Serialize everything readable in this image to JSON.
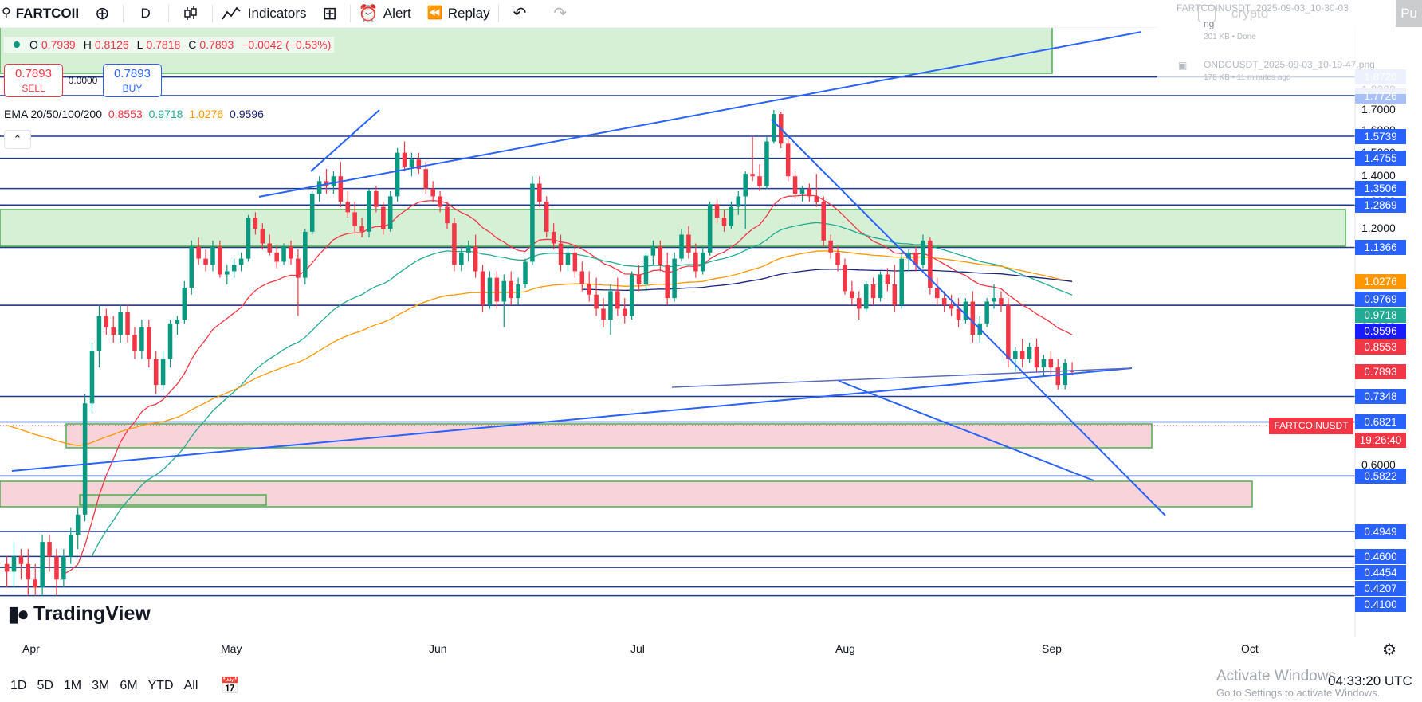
{
  "toolbar": {
    "symbol": "FARTCOII",
    "interval": "D",
    "indicators": "Indicators",
    "alert": "Alert",
    "replay": "Replay",
    "search_text": "crypto",
    "publish_partial": "Pu"
  },
  "downloads": {
    "item1_name": "FARTCOINUSDT_2025-09-03_10-30-03",
    "item1_partial": "ng",
    "item1_meta": "201 KB • Done",
    "item2_name": "ONDOUSDT_2025-09-03_10-19-47.png",
    "item2_meta": "178 KB • 11 minutes ago"
  },
  "legend": {
    "open_label": "O",
    "open": "0.7939",
    "high_label": "H",
    "high": "0.8126",
    "low_label": "L",
    "low": "0.7818",
    "close_label": "C",
    "close": "0.7893",
    "change": "−0.0042 (−0.53%)"
  },
  "trade": {
    "sell_price": "0.7893",
    "sell_label": "SELL",
    "spread": "0.0000",
    "buy_price": "0.7893",
    "buy_label": "BUY"
  },
  "ema": {
    "label": "EMA 20/50/100/200",
    "v20": "0.8553",
    "v50": "0.9718",
    "v100": "1.0276",
    "v200": "0.9596",
    "c20": "#f23645",
    "c50": "#22ab94",
    "c100": "#ff9800",
    "c200": "#1a237e"
  },
  "price_scale": {
    "plain": [
      "1.8000",
      "1.7000",
      "1.6000",
      "1.5000",
      "1.4000",
      "1.3000",
      "1.2000",
      "0.9000",
      "0.6000"
    ],
    "levels": [
      {
        "text": "1.8720",
        "bg": "#a9bff7"
      },
      {
        "text": "1.7726",
        "bg": "#a9bff7"
      },
      {
        "text": "1.5739",
        "bg": "#2962ff"
      },
      {
        "text": "1.4755",
        "bg": "#2962ff"
      },
      {
        "text": "1.3506",
        "bg": "#2962ff"
      },
      {
        "text": "1.2869",
        "bg": "#2962ff"
      },
      {
        "text": "1.1366",
        "bg": "#2962ff"
      },
      {
        "text": "1.0276",
        "bg": "#ff9800"
      },
      {
        "text": "0.9769",
        "bg": "#2962ff"
      },
      {
        "text": "0.9718",
        "bg": "#22ab94"
      },
      {
        "text": "0.9596",
        "bg": "#1a1aff"
      },
      {
        "text": "0.8553",
        "bg": "#f23645"
      },
      {
        "text": "0.7893",
        "bg": "#f23645"
      },
      {
        "text": "0.7348",
        "bg": "#2962ff"
      },
      {
        "text": "0.6821",
        "bg": "#2962ff"
      },
      {
        "text": "0.5822",
        "bg": "#2962ff"
      },
      {
        "text": "0.4949",
        "bg": "#2962ff"
      },
      {
        "text": "0.4600",
        "bg": "#2962ff"
      },
      {
        "text": "0.4454",
        "bg": "#2962ff"
      },
      {
        "text": "0.4207",
        "bg": "#2962ff"
      },
      {
        "text": "0.4100",
        "bg": "#2962ff"
      }
    ],
    "symbol_tag": "FARTCOINUSDT",
    "countdown": "19:26:40"
  },
  "time_axis": [
    "Apr",
    "May",
    "Jun",
    "Jul",
    "Aug",
    "Sep",
    "Oct"
  ],
  "branding": "TradingView",
  "bottom": {
    "ranges": [
      "1D",
      "5D",
      "1M",
      "3M",
      "6M",
      "YTD",
      "All"
    ],
    "clock": "04:33:20 UTC"
  },
  "watermark": {
    "title": "Activate Windows",
    "subtitle": "Go to Settings to activate Windows."
  },
  "chart_data": {
    "type": "candlestick",
    "symbol": "FARTCOINUSDT",
    "interval": "1D",
    "x_range": [
      "2025-03-30",
      "2025-10-15"
    ],
    "y_range": [
      0.39,
      1.93
    ],
    "candles": [
      [
        0.45,
        0.46,
        0.42,
        0.44
      ],
      [
        0.44,
        0.48,
        0.42,
        0.46
      ],
      [
        0.46,
        0.47,
        0.43,
        0.45
      ],
      [
        0.45,
        0.47,
        0.41,
        0.43
      ],
      [
        0.43,
        0.45,
        0.41,
        0.42
      ],
      [
        0.42,
        0.49,
        0.41,
        0.48
      ],
      [
        0.48,
        0.49,
        0.44,
        0.46
      ],
      [
        0.46,
        0.47,
        0.41,
        0.43
      ],
      [
        0.43,
        0.47,
        0.42,
        0.46
      ],
      [
        0.46,
        0.5,
        0.45,
        0.49
      ],
      [
        0.49,
        0.53,
        0.47,
        0.52
      ],
      [
        0.52,
        0.74,
        0.51,
        0.72
      ],
      [
        0.72,
        0.86,
        0.7,
        0.84
      ],
      [
        0.84,
        0.96,
        0.8,
        0.93
      ],
      [
        0.93,
        0.95,
        0.88,
        0.9
      ],
      [
        0.9,
        0.93,
        0.86,
        0.88
      ],
      [
        0.88,
        0.96,
        0.86,
        0.94
      ],
      [
        0.94,
        0.96,
        0.86,
        0.88
      ],
      [
        0.88,
        0.9,
        0.82,
        0.84
      ],
      [
        0.84,
        0.92,
        0.82,
        0.9
      ],
      [
        0.9,
        0.92,
        0.8,
        0.82
      ],
      [
        0.82,
        0.84,
        0.74,
        0.76
      ],
      [
        0.76,
        0.84,
        0.75,
        0.82
      ],
      [
        0.82,
        0.92,
        0.8,
        0.91
      ],
      [
        0.91,
        0.93,
        0.88,
        0.92
      ],
      [
        0.92,
        1.03,
        0.91,
        1.01
      ],
      [
        1.01,
        1.16,
        0.99,
        1.14
      ],
      [
        1.14,
        1.17,
        1.08,
        1.1
      ],
      [
        1.1,
        1.13,
        1.06,
        1.08
      ],
      [
        1.08,
        1.16,
        1.06,
        1.14
      ],
      [
        1.14,
        1.16,
        1.04,
        1.05
      ],
      [
        1.05,
        1.08,
        1.02,
        1.06
      ],
      [
        1.06,
        1.1,
        1.04,
        1.08
      ],
      [
        1.08,
        1.12,
        1.06,
        1.1
      ],
      [
        1.1,
        1.25,
        1.09,
        1.24
      ],
      [
        1.24,
        1.26,
        1.18,
        1.2
      ],
      [
        1.2,
        1.22,
        1.13,
        1.15
      ],
      [
        1.15,
        1.18,
        1.11,
        1.12
      ],
      [
        1.12,
        1.14,
        1.07,
        1.09
      ],
      [
        1.09,
        1.15,
        1.08,
        1.14
      ],
      [
        1.14,
        1.16,
        1.08,
        1.1
      ],
      [
        1.1,
        1.13,
        0.93,
        1.04
      ],
      [
        1.04,
        1.2,
        1.02,
        1.19
      ],
      [
        1.19,
        1.34,
        1.18,
        1.33
      ],
      [
        1.33,
        1.4,
        1.3,
        1.38
      ],
      [
        1.38,
        1.43,
        1.33,
        1.36
      ],
      [
        1.36,
        1.42,
        1.33,
        1.4
      ],
      [
        1.4,
        1.46,
        1.28,
        1.3
      ],
      [
        1.3,
        1.34,
        1.24,
        1.26
      ],
      [
        1.26,
        1.3,
        1.19,
        1.21
      ],
      [
        1.21,
        1.24,
        1.17,
        1.19
      ],
      [
        1.19,
        1.35,
        1.17,
        1.34
      ],
      [
        1.34,
        1.36,
        1.26,
        1.28
      ],
      [
        1.28,
        1.3,
        1.18,
        1.2
      ],
      [
        1.2,
        1.34,
        1.19,
        1.32
      ],
      [
        1.32,
        1.52,
        1.3,
        1.5
      ],
      [
        1.5,
        1.55,
        1.42,
        1.44
      ],
      [
        1.44,
        1.5,
        1.4,
        1.47
      ],
      [
        1.47,
        1.5,
        1.41,
        1.43
      ],
      [
        1.43,
        1.46,
        1.33,
        1.35
      ],
      [
        1.35,
        1.38,
        1.3,
        1.32
      ],
      [
        1.32,
        1.34,
        1.26,
        1.28
      ],
      [
        1.28,
        1.3,
        1.2,
        1.22
      ],
      [
        1.22,
        1.24,
        1.06,
        1.08
      ],
      [
        1.08,
        1.14,
        1.06,
        1.12
      ],
      [
        1.12,
        1.16,
        1.09,
        1.14
      ],
      [
        1.14,
        1.18,
        1.04,
        1.06
      ],
      [
        1.06,
        1.08,
        0.94,
        0.96
      ],
      [
        0.96,
        1.06,
        0.95,
        1.04
      ],
      [
        1.04,
        1.06,
        0.95,
        0.97
      ],
      [
        0.97,
        1.05,
        0.9,
        1.03
      ],
      [
        1.03,
        1.06,
        0.96,
        0.98
      ],
      [
        0.98,
        1.04,
        0.96,
        1.02
      ],
      [
        1.02,
        1.1,
        1.01,
        1.09
      ],
      [
        1.09,
        1.4,
        1.08,
        1.37
      ],
      [
        1.37,
        1.4,
        1.28,
        1.3
      ],
      [
        1.3,
        1.32,
        1.17,
        1.19
      ],
      [
        1.19,
        1.22,
        1.13,
        1.15
      ],
      [
        1.15,
        1.18,
        1.06,
        1.08
      ],
      [
        1.08,
        1.14,
        1.06,
        1.12
      ],
      [
        1.12,
        1.14,
        1.04,
        1.06
      ],
      [
        1.06,
        1.09,
        1.0,
        1.02
      ],
      [
        1.02,
        1.06,
        0.97,
        0.99
      ],
      [
        0.99,
        1.04,
        0.93,
        0.95
      ],
      [
        0.95,
        0.98,
        0.9,
        0.92
      ],
      [
        0.92,
        1.02,
        0.88,
        1.0
      ],
      [
        1.0,
        1.04,
        0.93,
        0.95
      ],
      [
        0.95,
        0.98,
        0.91,
        0.93
      ],
      [
        0.93,
        1.06,
        0.92,
        1.05
      ],
      [
        1.05,
        1.08,
        1.0,
        1.02
      ],
      [
        1.02,
        1.12,
        1.0,
        1.11
      ],
      [
        1.11,
        1.16,
        1.08,
        1.14
      ],
      [
        1.14,
        1.16,
        1.06,
        1.08
      ],
      [
        1.08,
        1.12,
        0.96,
        0.98
      ],
      [
        0.98,
        1.12,
        0.97,
        1.1
      ],
      [
        1.1,
        1.2,
        1.09,
        1.18
      ],
      [
        1.18,
        1.21,
        1.1,
        1.12
      ],
      [
        1.12,
        1.15,
        1.04,
        1.06
      ],
      [
        1.06,
        1.14,
        1.05,
        1.12
      ],
      [
        1.12,
        1.3,
        1.11,
        1.29
      ],
      [
        1.29,
        1.31,
        1.22,
        1.24
      ],
      [
        1.24,
        1.27,
        1.19,
        1.21
      ],
      [
        1.21,
        1.3,
        1.2,
        1.28
      ],
      [
        1.28,
        1.34,
        1.25,
        1.32
      ],
      [
        1.32,
        1.42,
        1.2,
        1.41
      ],
      [
        1.41,
        1.57,
        1.38,
        1.4
      ],
      [
        1.4,
        1.45,
        1.34,
        1.36
      ],
      [
        1.36,
        1.57,
        1.35,
        1.55
      ],
      [
        1.55,
        1.7,
        1.54,
        1.68
      ],
      [
        1.68,
        1.69,
        1.52,
        1.54
      ],
      [
        1.54,
        1.56,
        1.38,
        1.4
      ],
      [
        1.4,
        1.42,
        1.31,
        1.33
      ],
      [
        1.33,
        1.36,
        1.3,
        1.35
      ],
      [
        1.35,
        1.37,
        1.3,
        1.32
      ],
      [
        1.32,
        1.41,
        1.28,
        1.3
      ],
      [
        1.3,
        1.32,
        1.14,
        1.16
      ],
      [
        1.16,
        1.18,
        1.1,
        1.12
      ],
      [
        1.12,
        1.14,
        1.06,
        1.08
      ],
      [
        1.08,
        1.1,
        0.99,
        1.0
      ],
      [
        1.0,
        1.03,
        0.96,
        0.98
      ],
      [
        0.98,
        1.0,
        0.92,
        0.95
      ],
      [
        0.95,
        1.03,
        0.94,
        1.02
      ],
      [
        1.02,
        1.04,
        0.96,
        0.98
      ],
      [
        0.98,
        1.06,
        0.97,
        1.05
      ],
      [
        1.05,
        1.07,
        1.0,
        1.02
      ],
      [
        1.02,
        1.08,
        0.94,
        0.96
      ],
      [
        0.96,
        1.12,
        0.95,
        1.1
      ],
      [
        1.1,
        1.13,
        1.06,
        1.12
      ],
      [
        1.12,
        1.14,
        1.06,
        1.08
      ],
      [
        1.08,
        1.18,
        1.07,
        1.16
      ],
      [
        1.16,
        1.17,
        0.99,
        1.01
      ],
      [
        1.01,
        1.04,
        0.96,
        0.98
      ],
      [
        0.98,
        1.0,
        0.94,
        0.96
      ],
      [
        0.96,
        0.99,
        0.93,
        0.95
      ],
      [
        0.95,
        0.98,
        0.9,
        0.92
      ],
      [
        0.92,
        0.98,
        0.91,
        0.97
      ],
      [
        0.97,
        1.0,
        0.86,
        0.88
      ],
      [
        0.88,
        0.93,
        0.86,
        0.91
      ],
      [
        0.91,
        0.98,
        0.9,
        0.97
      ],
      [
        0.97,
        1.02,
        0.95,
        0.98
      ],
      [
        0.98,
        1.0,
        0.94,
        0.96
      ],
      [
        0.96,
        0.98,
        0.8,
        0.82
      ],
      [
        0.82,
        0.85,
        0.79,
        0.84
      ],
      [
        0.84,
        0.87,
        0.8,
        0.82
      ],
      [
        0.82,
        0.86,
        0.81,
        0.85
      ],
      [
        0.85,
        0.87,
        0.79,
        0.8
      ],
      [
        0.8,
        0.83,
        0.78,
        0.82
      ],
      [
        0.82,
        0.84,
        0.78,
        0.8
      ],
      [
        0.8,
        0.82,
        0.75,
        0.76
      ],
      [
        0.76,
        0.82,
        0.75,
        0.81
      ],
      [
        0.7939,
        0.8126,
        0.7818,
        0.7893
      ]
    ],
    "ema": [
      {
        "name": "EMA 20",
        "last": 0.8553
      },
      {
        "name": "EMA 50",
        "last": 0.9718
      },
      {
        "name": "EMA 100",
        "last": 1.0276
      },
      {
        "name": "EMA 200",
        "last": 0.9596
      }
    ],
    "horizontal_levels": [
      1.872,
      1.7726,
      1.5739,
      1.4755,
      1.3506,
      1.2869,
      1.1366,
      0.9596,
      0.7348,
      0.6821,
      0.5822,
      0.4949,
      0.46,
      0.4454,
      0.4207,
      0.41
    ],
    "zones": [
      {
        "from": 1.7726,
        "to": 1.95,
        "color": "green"
      },
      {
        "from": 1.2869,
        "to": 1.3506,
        "color": "green"
      },
      {
        "from": 0.7348,
        "to": 0.7893,
        "color": "red"
      },
      {
        "from": 0.5822,
        "to": 0.6821,
        "color": "red"
      }
    ]
  }
}
